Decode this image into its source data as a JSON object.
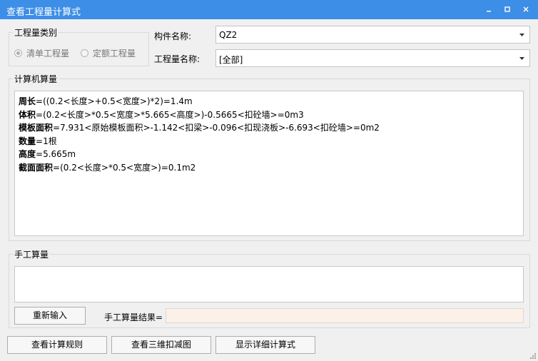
{
  "window": {
    "title": "查看工程量计算式",
    "colors": {
      "titlebar": "#3d8ee6",
      "result_field": "#fbf1e8"
    },
    "controls": [
      "minimize-icon",
      "maximize-icon",
      "close-icon"
    ]
  },
  "quantity_type": {
    "label": "工程量类别",
    "options": [
      {
        "label": "清单工程量",
        "selected": true
      },
      {
        "label": "定额工程量",
        "selected": false
      }
    ]
  },
  "component": {
    "label": "构件名称:",
    "value": "QZ2"
  },
  "quantity_name": {
    "label": "工程量名称:",
    "value": "[全部]"
  },
  "computer_calc": {
    "label": "计算机算量",
    "lines": [
      {
        "name": "周长",
        "expr": "=((0.2<长度>+0.5<宽度>)*2)=1.4m"
      },
      {
        "name": "体积",
        "expr": "=(0.2<长度>*0.5<宽度>*5.665<高度>)-0.5665<扣砼墙>=0m3"
      },
      {
        "name": "模板面积",
        "expr": "=7.931<原始模板面积>-1.142<扣梁>-0.096<扣现浇板>-6.693<扣砼墙>=0m2"
      },
      {
        "name": "数量",
        "expr": "=1根"
      },
      {
        "name": "高度",
        "expr": "=5.665m"
      },
      {
        "name": "截面面积",
        "expr": "=(0.2<长度>*0.5<宽度>)=0.1m2"
      }
    ]
  },
  "manual_calc": {
    "label": "手工算量",
    "reenter_label": "重新输入",
    "result_label": "手工算量结果=",
    "result_value": ""
  },
  "bottom_buttons": {
    "rules": "查看计算规则",
    "view3d": "查看三维扣减图",
    "detail": "显示详细计算式"
  }
}
